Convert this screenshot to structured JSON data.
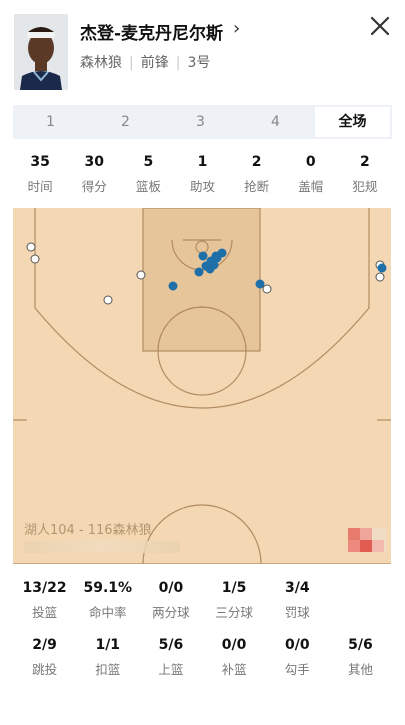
{
  "player": {
    "name": "杰登-麦克丹尼尔斯",
    "team": "森林狼",
    "position": "前锋",
    "number": "3号"
  },
  "tabs": [
    {
      "label": "1",
      "active": false
    },
    {
      "label": "2",
      "active": false
    },
    {
      "label": "3",
      "active": false
    },
    {
      "label": "4",
      "active": false
    },
    {
      "label": "全场",
      "active": true
    }
  ],
  "stats": [
    {
      "value": "35",
      "label": "时间"
    },
    {
      "value": "30",
      "label": "得分"
    },
    {
      "value": "5",
      "label": "篮板"
    },
    {
      "value": "1",
      "label": "助攻"
    },
    {
      "value": "2",
      "label": "抢断"
    },
    {
      "value": "0",
      "label": "盖帽"
    },
    {
      "value": "2",
      "label": "犯规"
    }
  ],
  "court": {
    "score_text": "湖人104 - 116森林狼",
    "colors": {
      "floor": "#f3d8b3",
      "paint": "#e7c59b",
      "line": "#b28c63",
      "made": "#1f6fa8",
      "missed": "#ffffff"
    }
  },
  "shooting_row1": [
    {
      "value": "13/22",
      "label": "投篮"
    },
    {
      "value": "59.1%",
      "label": "命中率"
    },
    {
      "value": "0/0",
      "label": "两分球"
    },
    {
      "value": "1/5",
      "label": "三分球"
    },
    {
      "value": "3/4",
      "label": "罚球"
    }
  ],
  "shooting_row2": [
    {
      "value": "2/9",
      "label": "跳投"
    },
    {
      "value": "1/1",
      "label": "扣篮"
    },
    {
      "value": "5/6",
      "label": "上篮"
    },
    {
      "value": "0/0",
      "label": "补篮"
    },
    {
      "value": "0/0",
      "label": "勾手"
    },
    {
      "value": "5/6",
      "label": "其他"
    }
  ]
}
